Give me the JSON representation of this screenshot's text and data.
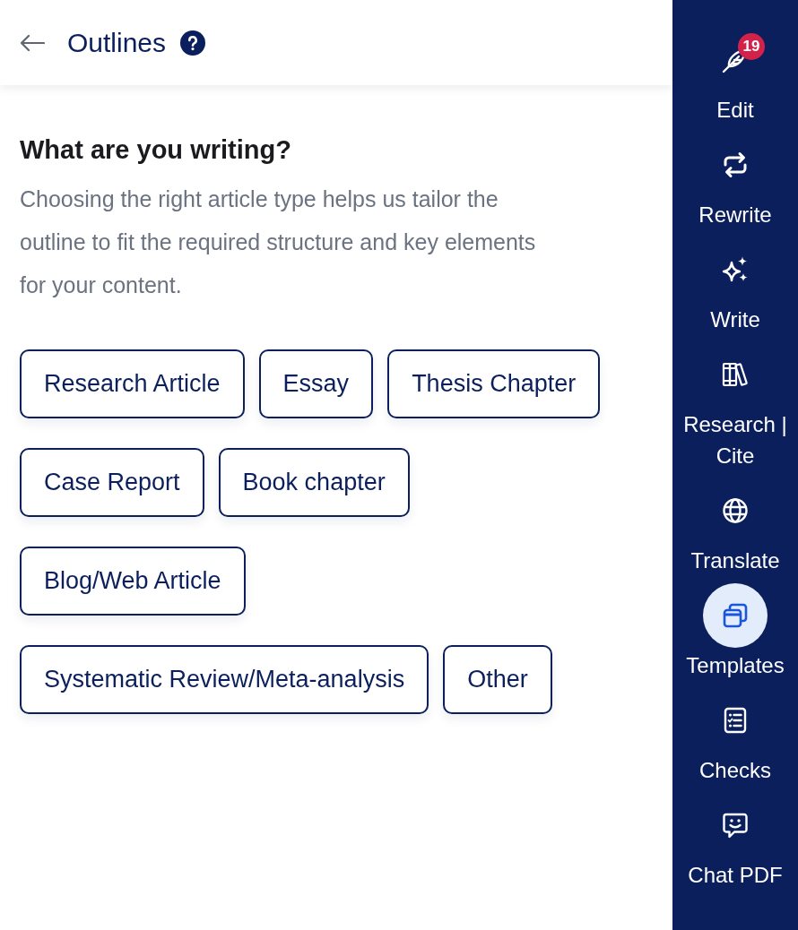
{
  "header": {
    "title": "Outlines"
  },
  "prompt": {
    "heading": "What are you writing?",
    "description": "Choosing the right article type helps us tailor the outline to fit the required structure and key elements for your content."
  },
  "article_types": [
    {
      "label": "Research Article",
      "selected": false
    },
    {
      "label": "Essay",
      "selected": false
    },
    {
      "label": "Thesis Chapter",
      "selected": false
    },
    {
      "label": "Case Report",
      "selected": false
    },
    {
      "label": "Book chapter",
      "selected": false
    },
    {
      "label": "Blog/Web Article",
      "selected": false
    },
    {
      "label": "Systematic Review/Meta-analysis",
      "selected": false
    },
    {
      "label": "Other",
      "selected": false
    }
  ],
  "sidebar": {
    "items": [
      {
        "label": "Edit",
        "badge": "19",
        "selected": false
      },
      {
        "label": "Rewrite",
        "selected": false
      },
      {
        "label": "Write",
        "selected": false
      },
      {
        "label": "Research | Cite",
        "selected": false
      },
      {
        "label": "Translate",
        "selected": false
      },
      {
        "label": "Templates",
        "selected": true
      },
      {
        "label": "Checks",
        "selected": false
      },
      {
        "label": "Chat PDF",
        "selected": false
      }
    ]
  }
}
